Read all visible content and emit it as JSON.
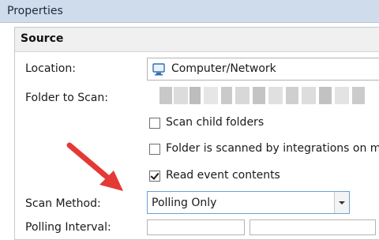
{
  "window": {
    "title": "Properties"
  },
  "section": {
    "title": "Source"
  },
  "fields": {
    "location": {
      "label": "Location:",
      "value": "Computer/Network",
      "icon": "monitor-icon"
    },
    "folder_to_scan": {
      "label": "Folder to Scan:",
      "value_redacted": true
    },
    "scan_method": {
      "label": "Scan Method:",
      "value": "Polling Only"
    },
    "polling_interval": {
      "label": "Polling Interval:"
    }
  },
  "checkboxes": [
    {
      "label": "Scan child folders",
      "checked": false
    },
    {
      "label": "Folder is scanned by integrations on mult",
      "checked": false
    },
    {
      "label": "Read event contents",
      "checked": true
    }
  ],
  "colors": {
    "titlebar": "#cfdcec",
    "accent_arrow": "#e53935",
    "focus_border": "#6f9fd8"
  }
}
